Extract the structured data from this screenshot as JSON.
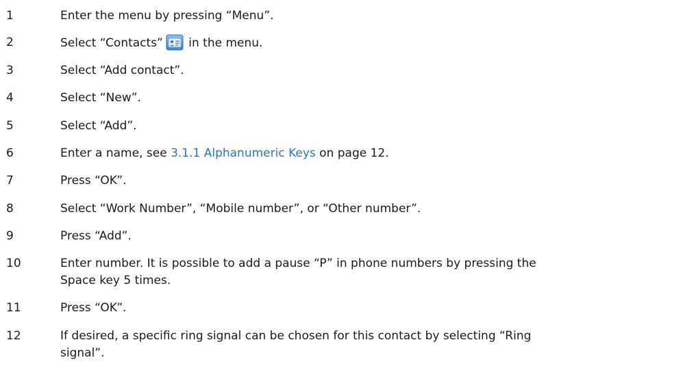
{
  "steps": [
    {
      "num": "1",
      "text": "Enter the menu by pressing “Menu”."
    },
    {
      "num": "2",
      "text_before": "Select “Contacts”",
      "icon": "contacts-icon",
      "text_after": "in the menu."
    },
    {
      "num": "3",
      "text": "Select “Add contact”."
    },
    {
      "num": "4",
      "text": "Select “New”."
    },
    {
      "num": "5",
      "text": "Select “Add”."
    },
    {
      "num": "6",
      "text_before": "Enter a name, see ",
      "link": "3.1.1 Alphanumeric Keys",
      "text_after": " on page 12."
    },
    {
      "num": "7",
      "text": "Press “OK”."
    },
    {
      "num": "8",
      "text": "Select “Work Number”, “Mobile number”, or “Other number”."
    },
    {
      "num": "9",
      "text": "Press “Add”."
    },
    {
      "num": "10",
      "line1": "Enter number. It is possible to add a pause “P” in phone numbers by pressing the",
      "line2": "Space key 5 times."
    },
    {
      "num": "11",
      "text": "Press “OK”."
    },
    {
      "num": "12",
      "line1": "If desired, a specific ring signal can be chosen for this contact by selecting “Ring",
      "line2": "signal”."
    }
  ],
  "colors": {
    "text": "#1a1a1a",
    "link": "#2a73c6"
  }
}
